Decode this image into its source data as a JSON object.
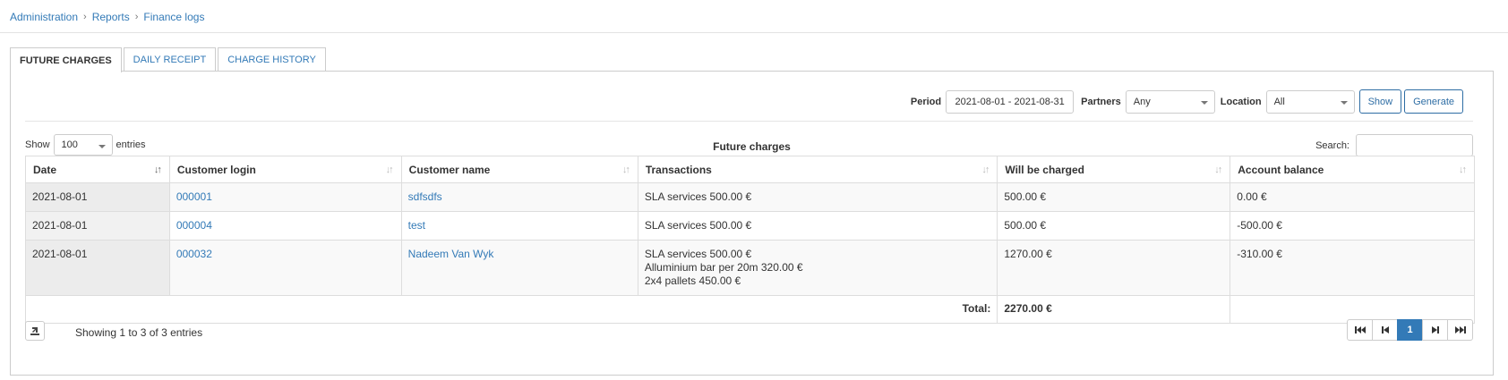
{
  "breadcrumb": [
    "Administration",
    "Reports",
    "Finance logs"
  ],
  "tabs": [
    {
      "label": "FUTURE CHARGES",
      "active": true
    },
    {
      "label": "DAILY RECEIPT",
      "active": false
    },
    {
      "label": "CHARGE HISTORY",
      "active": false
    }
  ],
  "filters": {
    "period_label": "Period",
    "period_value": "2021-08-01 - 2021-08-31",
    "partners_label": "Partners",
    "partners_value": "Any",
    "location_label": "Location",
    "location_value": "All",
    "show_button": "Show",
    "generate_button": "Generate"
  },
  "table_controls": {
    "show_label": "Show",
    "entries_value": "100",
    "entries_label": "entries",
    "title": "Future charges",
    "search_label": "Search:"
  },
  "table": {
    "columns": [
      "Date",
      "Customer login",
      "Customer name",
      "Transactions",
      "Will be charged",
      "Account balance"
    ],
    "rows": [
      {
        "date": "2021-08-01",
        "login": "000001",
        "name": "sdfsdfs",
        "transactions": [
          "SLA services 500.00 €"
        ],
        "charged": "500.00 €",
        "balance": "0.00 €"
      },
      {
        "date": "2021-08-01",
        "login": "000004",
        "name": "test",
        "transactions": [
          "SLA services 500.00 €"
        ],
        "charged": "500.00 €",
        "balance": "-500.00 €"
      },
      {
        "date": "2021-08-01",
        "login": "000032",
        "name": "Nadeem Van Wyk",
        "transactions": [
          "SLA services 500.00 €",
          "Alluminium bar per 20m 320.00 €",
          "2x4 pallets 450.00 €"
        ],
        "charged": "1270.00 €",
        "balance": "-310.00 €"
      }
    ],
    "total_label": "Total:",
    "total_value": "2270.00 €"
  },
  "footer": {
    "info": "Showing 1 to 3 of 3 entries",
    "current_page": "1"
  },
  "colors": {
    "link": "#337ab7",
    "negative": "#e60000",
    "active_page": "#337ab7"
  },
  "icons": {
    "export": "export-icon",
    "first": "first-page-icon",
    "prev": "prev-page-icon",
    "next": "next-page-icon",
    "last": "last-page-icon",
    "sort": "sort-icon"
  }
}
